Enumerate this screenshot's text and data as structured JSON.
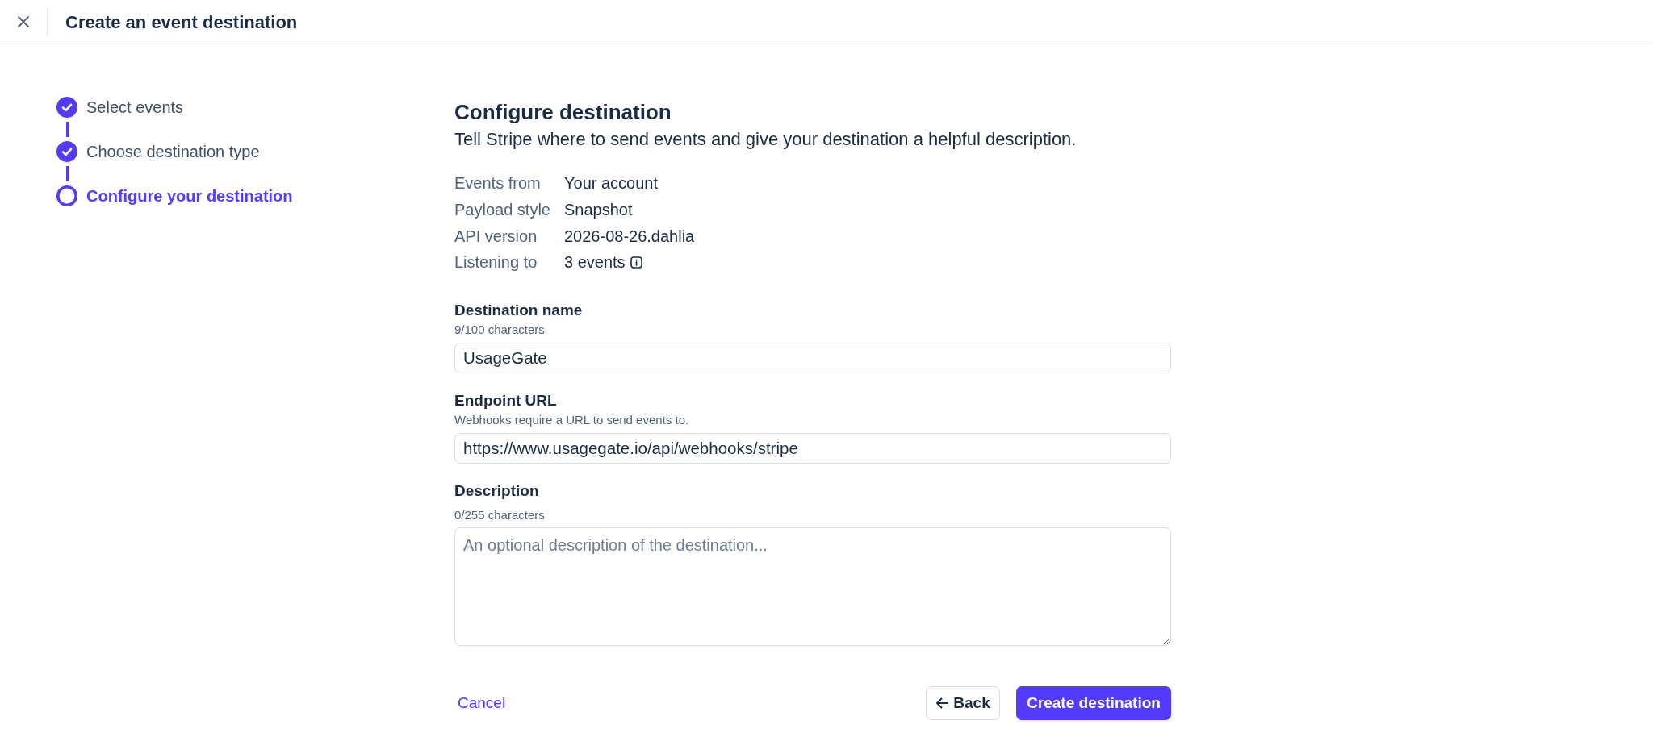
{
  "header": {
    "title": "Create an event destination"
  },
  "steps": [
    {
      "label": "Select events",
      "completed": true,
      "selected": false
    },
    {
      "label": "Choose destination type",
      "completed": true,
      "selected": false
    },
    {
      "label": "Configure your destination",
      "completed": false,
      "selected": true
    }
  ],
  "form": {
    "title": "Configure destination",
    "subtitle": "Tell Stripe where to send events and give your destination a helpful description.",
    "summary": [
      {
        "label": "Events from",
        "value": "Your account",
        "info": false
      },
      {
        "label": "Payload style",
        "value": "Snapshot",
        "info": false
      },
      {
        "label": "API version",
        "value": "2026-08-26.dahlia",
        "info": false
      },
      {
        "label": "Listening to",
        "value": "3 events",
        "info": true
      }
    ],
    "fields": [
      {
        "kind": "input",
        "label": "Destination name",
        "hint": "9/100 characters",
        "value": "UsageGate"
      },
      {
        "kind": "input",
        "label": "Endpoint URL",
        "hint": "Webhooks require a URL to send events to.",
        "value": "https://www.usagegate.io/api/webhooks/stripe"
      },
      {
        "kind": "textarea",
        "label": "Description",
        "hint": "0/255 characters",
        "placeholder": "An optional description of the destination..."
      }
    ]
  },
  "actions": {
    "cancel": "Cancel",
    "back": "Back",
    "submit": "Create destination"
  }
}
